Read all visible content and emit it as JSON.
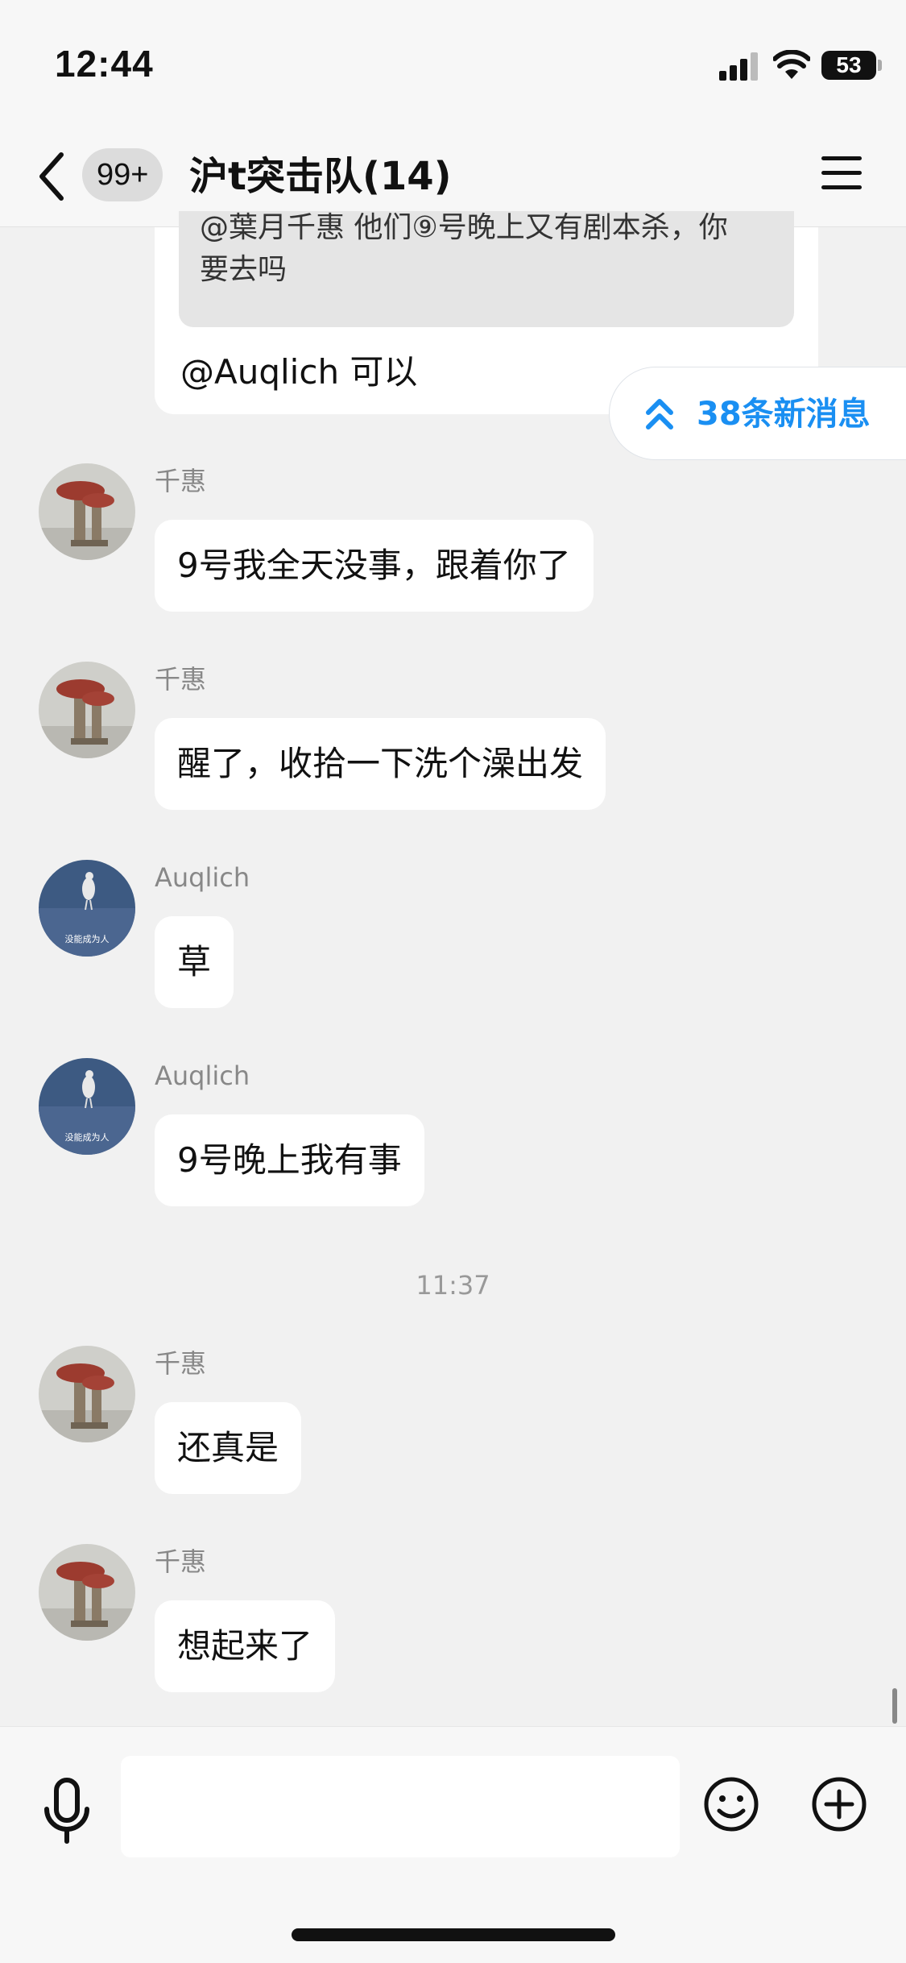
{
  "status_bar": {
    "time": "12:44",
    "battery": "53",
    "icons": [
      "signal-icon",
      "wifi-icon",
      "battery-icon"
    ]
  },
  "header": {
    "back_icon": "chevron-left-icon",
    "unread_badge": "99+",
    "title": "沪t突击队(14)",
    "menu_icon": "hamburger-menu-icon"
  },
  "quoted_message": {
    "quote_line1": "@葉月千惠 他们⑨号晚上又有剧本杀，你",
    "quote_line2": "要去吗",
    "reply": "@Auqlich 可以"
  },
  "new_messages_pill": {
    "icon": "double-chevron-up-icon",
    "label": "38条新消息",
    "color": "#1a8ff2"
  },
  "messages": [
    {
      "sender": "千惠",
      "text": "9号我全天没事，跟着你了",
      "avatar": "mushroom-avatar"
    },
    {
      "sender": "千惠",
      "text": "醒了，收拾一下洗个澡出发",
      "avatar": "mushroom-avatar"
    },
    {
      "sender": "Auqlich",
      "text": "草",
      "avatar": "bird-avatar"
    },
    {
      "sender": "Auqlich",
      "text": "9号晚上我有事",
      "avatar": "bird-avatar"
    },
    {
      "sender": "千惠",
      "text": "还真是",
      "avatar": "mushroom-avatar"
    },
    {
      "sender": "千惠",
      "text": "想起来了",
      "avatar": "mushroom-avatar"
    }
  ],
  "time_separator": "11:37",
  "input_bar": {
    "value": "",
    "placeholder": "",
    "icons": [
      "microphone-icon",
      "emoji-icon",
      "plus-circle-icon"
    ]
  },
  "avatar_caption": "没能成为人"
}
